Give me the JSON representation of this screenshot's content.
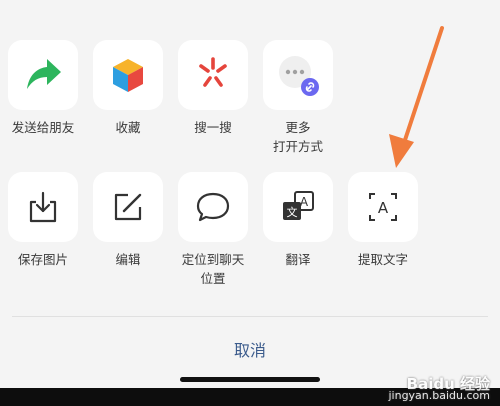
{
  "row1": [
    {
      "label": "发送给朋友",
      "icon": "share-arrow-icon"
    },
    {
      "label": "收藏",
      "icon": "favorite-cube-icon"
    },
    {
      "label": "搜一搜",
      "icon": "search-one-search-icon"
    },
    {
      "label": "更多\n打开方式",
      "icon": "more-open-with-icon"
    }
  ],
  "row2": [
    {
      "label": "保存图片",
      "icon": "save-image-icon"
    },
    {
      "label": "编辑",
      "icon": "edit-icon"
    },
    {
      "label": "定位到聊天\n位置",
      "icon": "chat-bubble-icon"
    },
    {
      "label": "翻译",
      "icon": "translate-icon"
    },
    {
      "label": "提取文字",
      "icon": "extract-text-icon"
    }
  ],
  "cancel_label": "取消",
  "watermark": {
    "main": "Baidu 经验",
    "sub": "jingyan.baidu.com"
  },
  "colors": {
    "accent": "#3b5b8c",
    "arrow": "#f07c3d",
    "share_green": "#2db55d"
  }
}
